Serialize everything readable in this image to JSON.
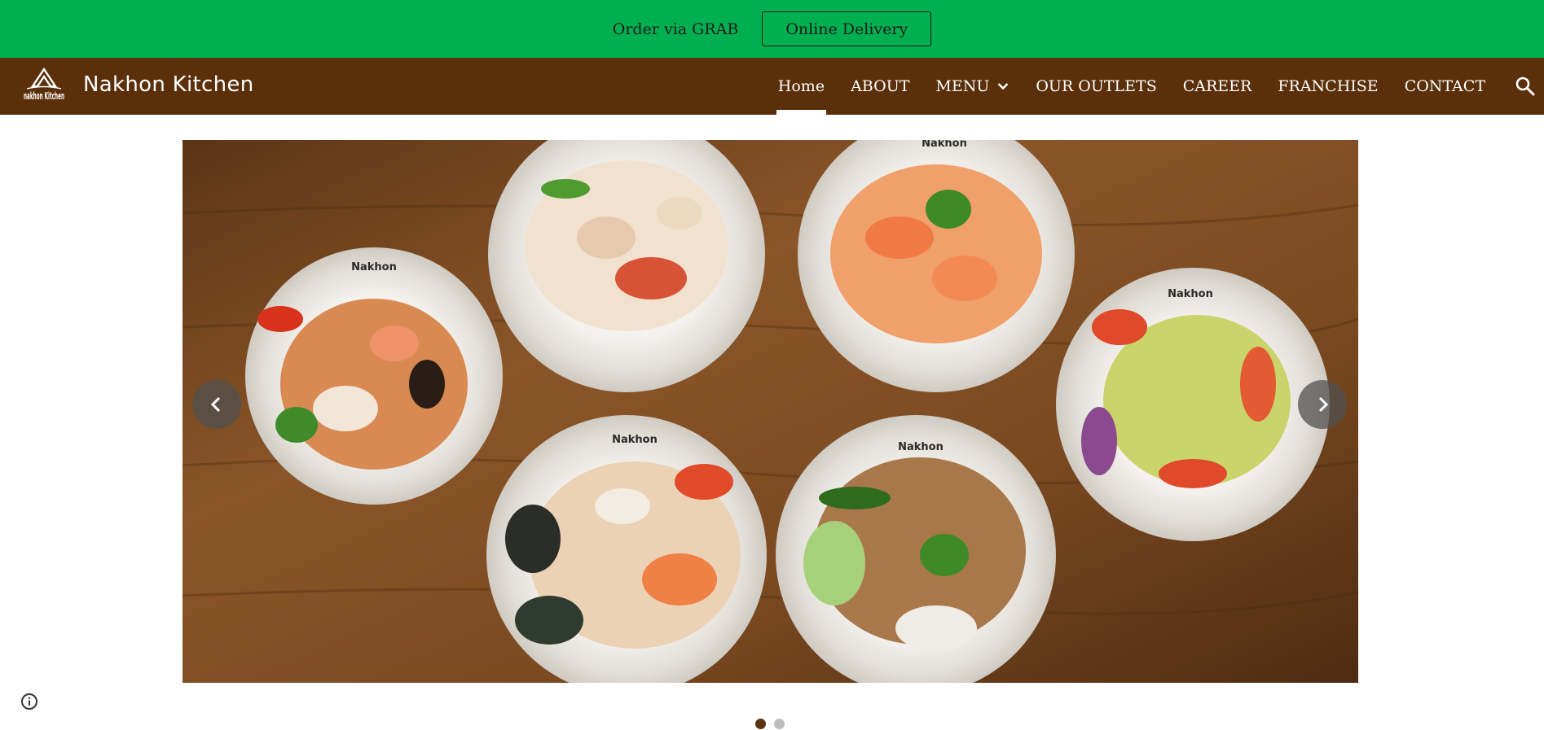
{
  "promo": {
    "text": "Order via GRAB",
    "button_label": "Online Delivery"
  },
  "header": {
    "site_title": "Nakhon Kitchen",
    "logo_text": "nakhon Kitchen",
    "nav": [
      {
        "label": "Home",
        "active": true
      },
      {
        "label": "ABOUT"
      },
      {
        "label": "MENU",
        "has_dropdown": true
      },
      {
        "label": "OUR OUTLETS"
      },
      {
        "label": "CAREER"
      },
      {
        "label": "FRANCHISE"
      },
      {
        "label": "CONTACT"
      }
    ],
    "search_icon": "search-icon"
  },
  "carousel": {
    "slide_count": 2,
    "active_slide": 1,
    "plate_brand": "Nakhon",
    "prev_icon": "chevron-left-icon",
    "next_icon": "chevron-right-icon"
  },
  "colors": {
    "promo_green": "#00b050",
    "nav_brown": "#5a2f0a",
    "dot_active": "#5a3410",
    "dot_inactive": "#bdbdbd"
  },
  "footer": {
    "info_icon": "info-icon"
  }
}
